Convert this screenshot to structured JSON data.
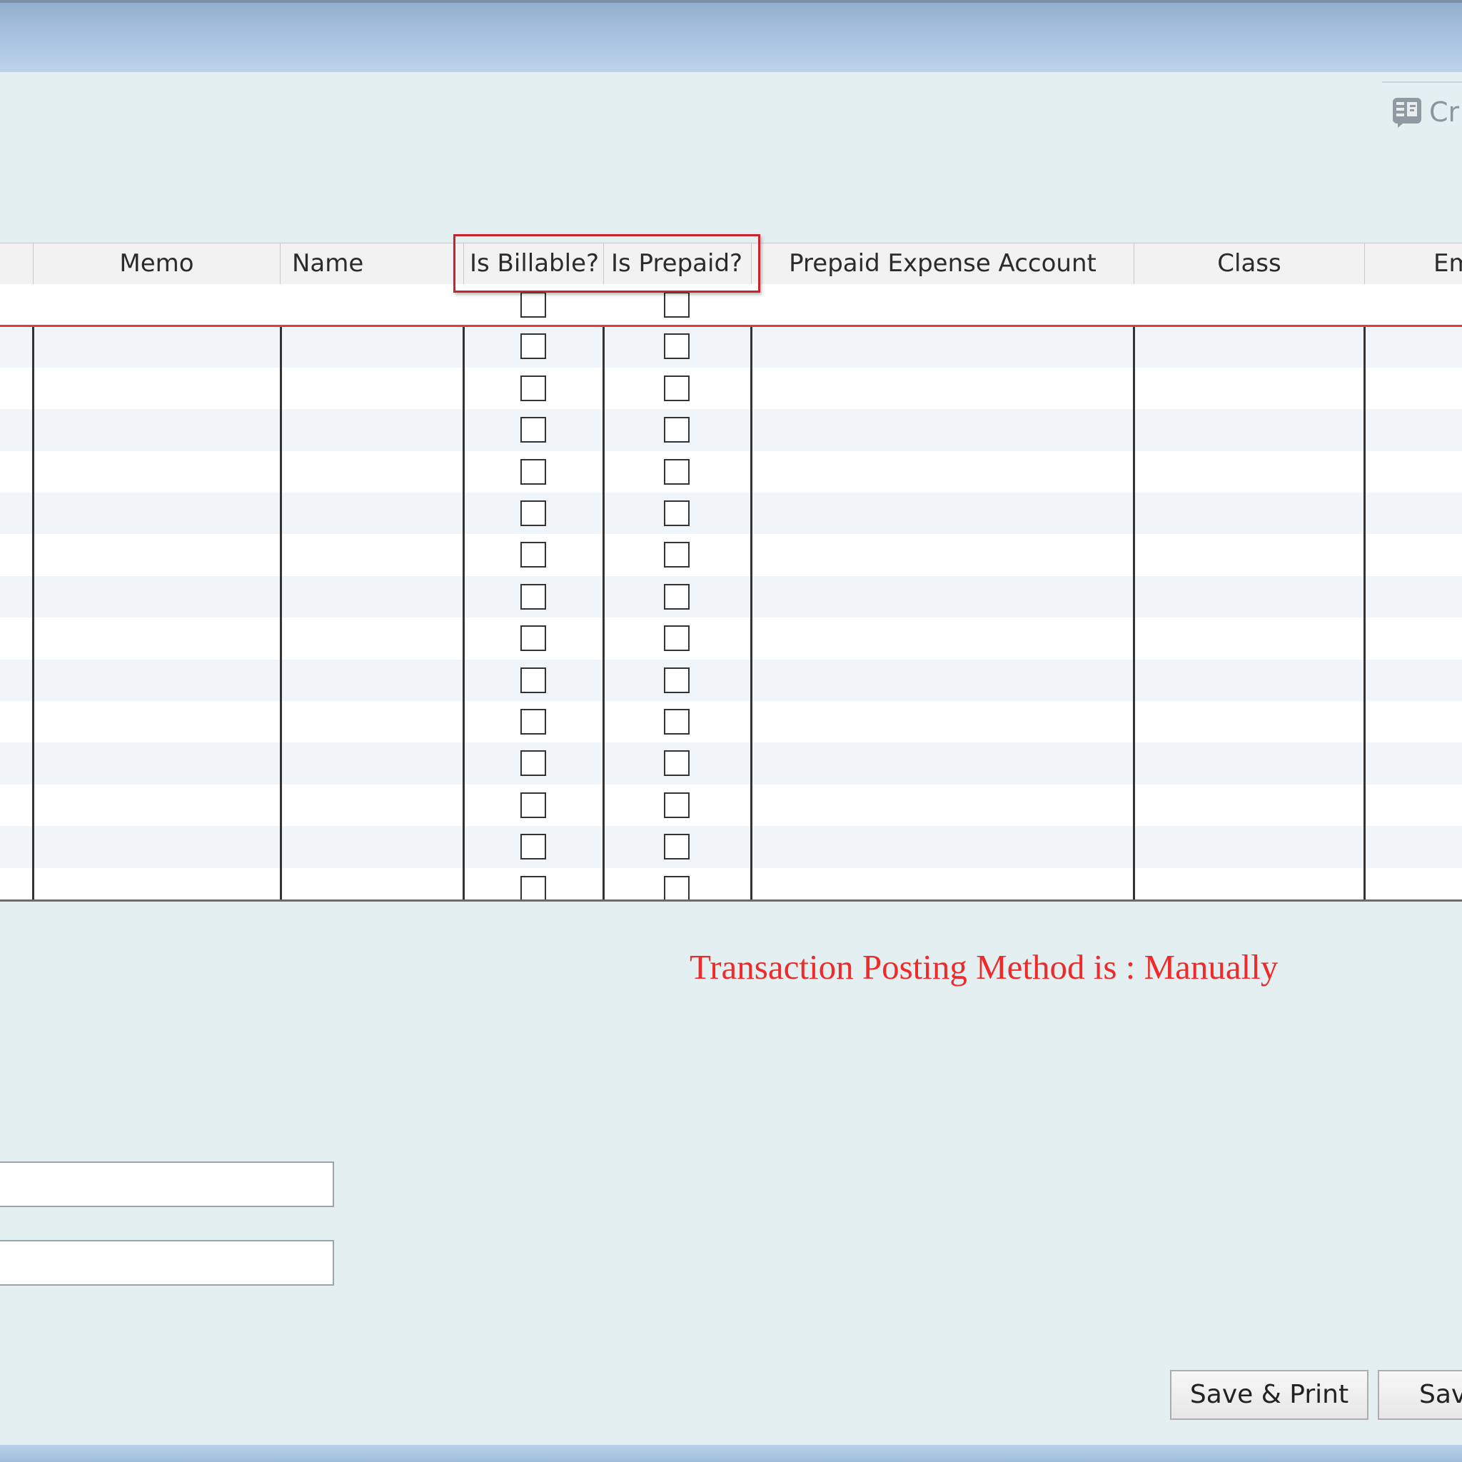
{
  "toolbar": {
    "create_label": "Cr"
  },
  "grid": {
    "columns": [
      {
        "key": "memo",
        "label": "Memo"
      },
      {
        "key": "name",
        "label": "Name"
      },
      {
        "key": "billable",
        "label": "Is Billable?"
      },
      {
        "key": "prepaid",
        "label": "Is Prepaid?"
      },
      {
        "key": "prepaid_account",
        "label": "Prepaid Expense Account"
      },
      {
        "key": "class",
        "label": "Class"
      },
      {
        "key": "em",
        "label": "Em"
      }
    ],
    "row_count": 15,
    "is_billable": [
      false,
      false,
      false,
      false,
      false,
      false,
      false,
      false,
      false,
      false,
      false,
      false,
      false,
      false,
      false
    ],
    "is_prepaid": [
      false,
      false,
      false,
      false,
      false,
      false,
      false,
      false,
      false,
      false,
      false,
      false,
      false,
      false,
      false
    ]
  },
  "status": {
    "posting_method": "Transaction Posting Method is : Manually"
  },
  "footer": {
    "save_print_label": "Save & Print",
    "save_label": "Sav"
  },
  "colors": {
    "status_text": "#ee2a2a",
    "highlight_border": "#c8242d",
    "background": "#e4eff2"
  }
}
